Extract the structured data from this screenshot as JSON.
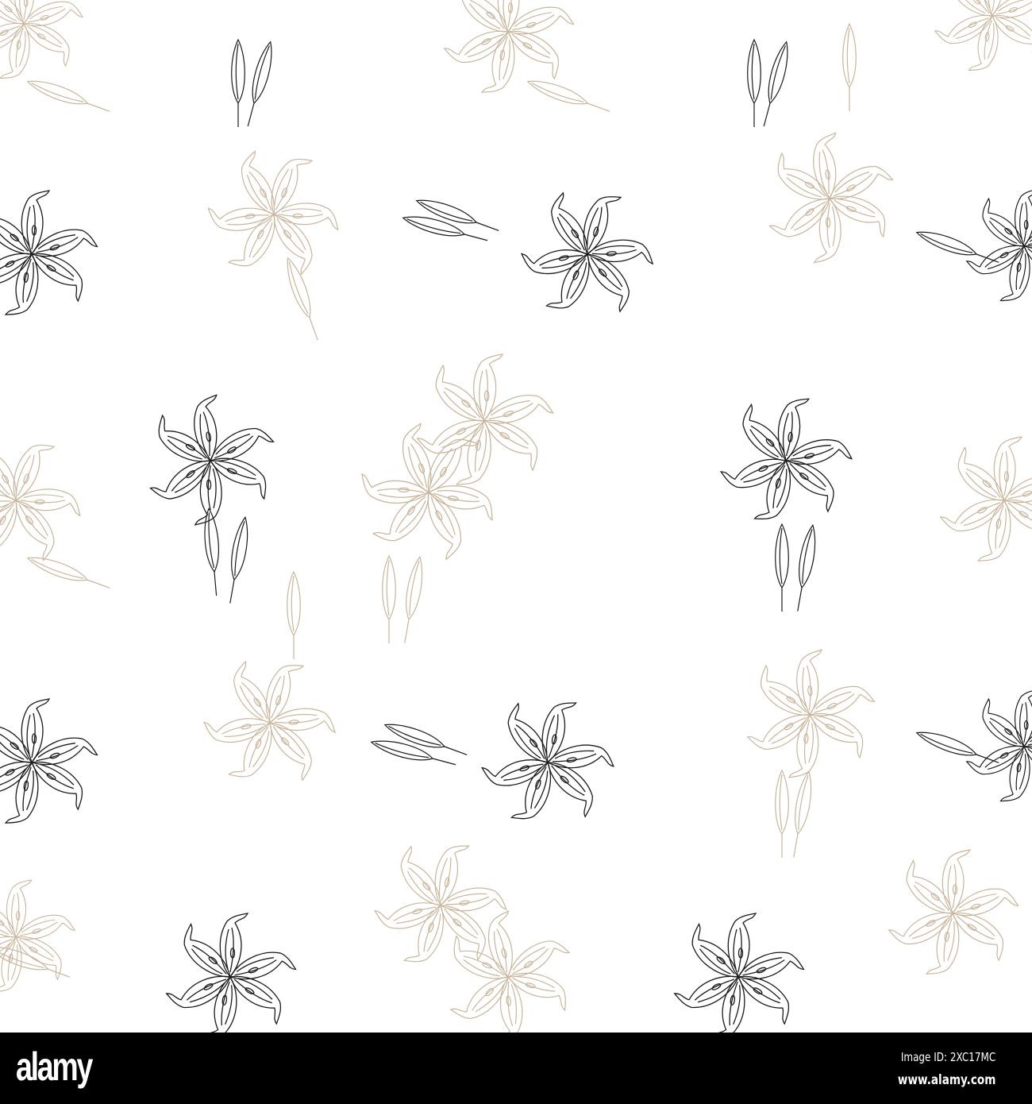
{
  "pattern": {
    "colors": {
      "dark": "#1a1a1a",
      "beige": "#c9b59c",
      "background": "#ffffff"
    }
  },
  "footer": {
    "logo": "alamy",
    "image_id": "Image ID: 2XC17MC",
    "website": "www.alamy.com"
  }
}
